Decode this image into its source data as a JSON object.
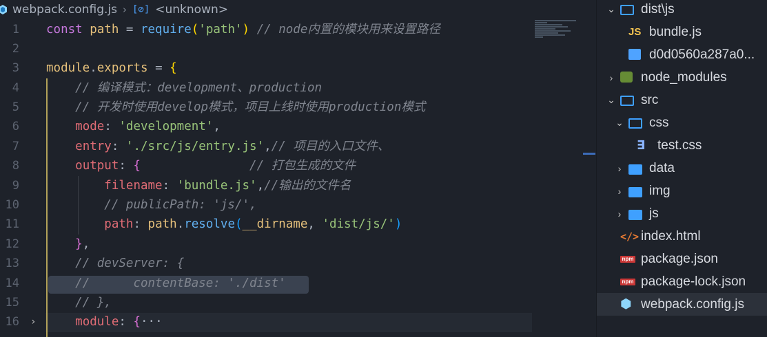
{
  "breadcrumb": {
    "file": "webpack.config.js",
    "separator": "›",
    "symbol_icon": "[⊘]",
    "symbol": "<unknown>"
  },
  "code": {
    "lines": [
      {
        "n": "1",
        "parts": [
          [
            "kw",
            "const "
          ],
          [
            "var",
            "path"
          ],
          [
            "plain",
            " = "
          ],
          [
            "fn",
            "require"
          ],
          [
            "brace",
            "("
          ],
          [
            "str",
            "'path'"
          ],
          [
            "brace",
            ")"
          ],
          [
            "plain",
            " "
          ],
          [
            "cm",
            "// node内置的模块用来设置路径"
          ]
        ]
      },
      {
        "n": "2",
        "parts": []
      },
      {
        "n": "3",
        "parts": [
          [
            "var",
            "module"
          ],
          [
            "plain",
            "."
          ],
          [
            "var",
            "exports"
          ],
          [
            "plain",
            " = "
          ],
          [
            "brace",
            "{"
          ]
        ]
      },
      {
        "n": "4",
        "parts": [
          [
            "plain",
            "    "
          ],
          [
            "cm",
            "// 编译模式：development、production"
          ]
        ]
      },
      {
        "n": "5",
        "parts": [
          [
            "plain",
            "    "
          ],
          [
            "cm",
            "// 开发时使用develop模式，项目上线时使用production模式"
          ]
        ]
      },
      {
        "n": "6",
        "parts": [
          [
            "plain",
            "    "
          ],
          [
            "prop",
            "mode"
          ],
          [
            "plain",
            ": "
          ],
          [
            "str",
            "'development'"
          ],
          [
            "plain",
            ","
          ]
        ]
      },
      {
        "n": "7",
        "parts": [
          [
            "plain",
            "    "
          ],
          [
            "prop",
            "entry"
          ],
          [
            "plain",
            ": "
          ],
          [
            "str",
            "'./src/js/entry.js'"
          ],
          [
            "plain",
            ","
          ],
          [
            "cm",
            "// 项目的入口文件、"
          ]
        ]
      },
      {
        "n": "8",
        "parts": [
          [
            "plain",
            "    "
          ],
          [
            "prop",
            "output"
          ],
          [
            "plain",
            ": "
          ],
          [
            "brace2",
            "{"
          ],
          [
            "plain",
            "               "
          ],
          [
            "cm",
            "// 打包生成的文件"
          ]
        ]
      },
      {
        "n": "9",
        "parts": [
          [
            "plain",
            "        "
          ],
          [
            "prop",
            "filename"
          ],
          [
            "plain",
            ": "
          ],
          [
            "str",
            "'bundle.js'"
          ],
          [
            "plain",
            ","
          ],
          [
            "cm",
            "//输出的文件名"
          ]
        ]
      },
      {
        "n": "10",
        "parts": [
          [
            "plain",
            "        "
          ],
          [
            "cm",
            "// publicPath: 'js/',"
          ]
        ]
      },
      {
        "n": "11",
        "parts": [
          [
            "plain",
            "        "
          ],
          [
            "prop",
            "path"
          ],
          [
            "plain",
            ": "
          ],
          [
            "var",
            "path"
          ],
          [
            "plain",
            "."
          ],
          [
            "fn",
            "resolve"
          ],
          [
            "brace3",
            "("
          ],
          [
            "var",
            "__dirname"
          ],
          [
            "plain",
            ", "
          ],
          [
            "str",
            "'dist/js/'"
          ],
          [
            "brace3",
            ")"
          ]
        ]
      },
      {
        "n": "12",
        "parts": [
          [
            "plain",
            "    "
          ],
          [
            "brace2",
            "}"
          ],
          [
            "plain",
            ","
          ]
        ]
      },
      {
        "n": "13",
        "parts": [
          [
            "plain",
            "    "
          ],
          [
            "cm",
            "// devServer: {"
          ]
        ]
      },
      {
        "n": "14",
        "parts": [
          [
            "plain",
            "    "
          ],
          [
            "cm",
            "//      contentBase: './dist'"
          ]
        ]
      },
      {
        "n": "15",
        "parts": [
          [
            "plain",
            "    "
          ],
          [
            "cm",
            "// },"
          ]
        ]
      },
      {
        "n": "16",
        "parts": [
          [
            "plain",
            "    "
          ],
          [
            "prop",
            "module"
          ],
          [
            "plain",
            ": "
          ],
          [
            "brace2",
            "{"
          ],
          [
            "plain",
            "···"
          ]
        ]
      }
    ],
    "fold_marker": "›"
  },
  "explorer": {
    "items": [
      {
        "label": "dist\\js",
        "icon": "folder-open-icon",
        "chevron": "⌄",
        "indent": 0,
        "kind": "folder-open"
      },
      {
        "label": "bundle.js",
        "icon": "js-file-icon",
        "chevron": "",
        "indent": 1,
        "kind": "js"
      },
      {
        "label": "d0d0560a287a0...",
        "icon": "image-file-icon",
        "chevron": "",
        "indent": 1,
        "kind": "img"
      },
      {
        "label": "node_modules",
        "icon": "node-folder-icon",
        "chevron": "›",
        "indent": 0,
        "kind": "node"
      },
      {
        "label": "src",
        "icon": "folder-open-icon",
        "chevron": "⌄",
        "indent": 0,
        "kind": "folder-open"
      },
      {
        "label": "css",
        "icon": "folder-open-icon",
        "chevron": "⌄",
        "indent": 1,
        "kind": "folder-open"
      },
      {
        "label": "test.css",
        "icon": "css-file-icon",
        "chevron": "",
        "indent": 2,
        "kind": "css"
      },
      {
        "label": "data",
        "icon": "folder-icon",
        "chevron": "›",
        "indent": 1,
        "kind": "folder"
      },
      {
        "label": "img",
        "icon": "folder-icon",
        "chevron": "›",
        "indent": 1,
        "kind": "folder"
      },
      {
        "label": "js",
        "icon": "folder-icon",
        "chevron": "›",
        "indent": 1,
        "kind": "folder"
      },
      {
        "label": "index.html",
        "icon": "html-file-icon",
        "chevron": "",
        "indent": 0,
        "kind": "html"
      },
      {
        "label": "package.json",
        "icon": "npm-file-icon",
        "chevron": "",
        "indent": 0,
        "kind": "npm"
      },
      {
        "label": "package-lock.json",
        "icon": "npm-file-icon",
        "chevron": "",
        "indent": 0,
        "kind": "npm"
      },
      {
        "label": "webpack.config.js",
        "icon": "webpack-file-icon",
        "chevron": "",
        "indent": 0,
        "kind": "webpack",
        "selected": true
      }
    ],
    "icon_glyphs": {
      "js": "JS",
      "css": "∃",
      "html": "</>",
      "npm": "npm",
      "webpack": "⬢"
    }
  },
  "colors": {
    "background": "#1e222a",
    "keyword": "#c678dd",
    "variable": "#e5c07b",
    "property": "#e06c75",
    "function": "#61afef",
    "string": "#98c379",
    "comment": "#7f848e",
    "folder": "#3fa0ff"
  }
}
